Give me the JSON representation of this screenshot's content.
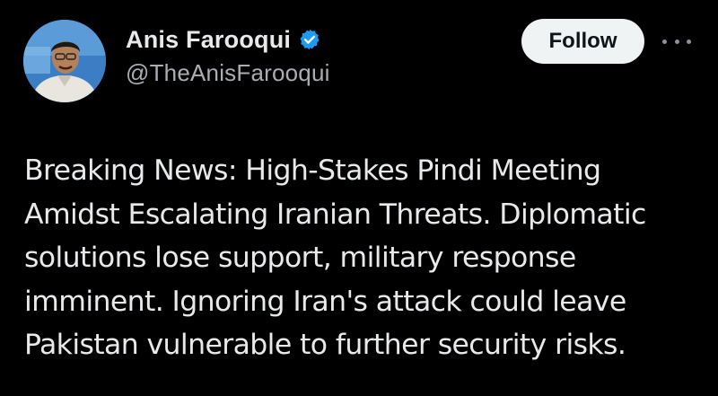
{
  "author": {
    "display_name": "Anis Farooqui",
    "handle": "@TheAnisFarooqui",
    "avatar_icon": "profile-photo",
    "verified_icon": "verified-badge-icon",
    "verified_color": "#1d9bf0"
  },
  "actions": {
    "follow_label": "Follow",
    "more_icon": "more-horizontal-icon"
  },
  "tweet": {
    "lines": [
      "Breaking News: High-Stakes Pindi Meeting",
      "Amidst Escalating Iranian Threats. Diplomatic",
      "solutions lose support, military response",
      "imminent. Ignoring Iran's attack could leave",
      "Pakistan vulnerable to further security risks."
    ]
  },
  "colors": {
    "background": "#000000",
    "text": "#e7e9ea",
    "secondary_text": "#a9aeb3",
    "follow_bg": "#eff3f4"
  }
}
